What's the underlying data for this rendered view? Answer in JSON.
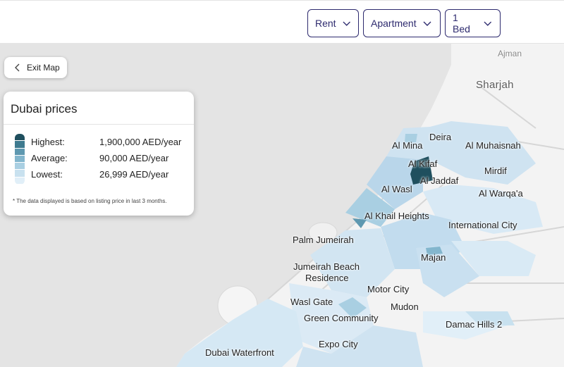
{
  "filters": {
    "listing": "Rent",
    "property_type": "Apartment",
    "bedrooms": "1 Bed"
  },
  "exit_label": "Exit Map",
  "legend": {
    "title": "Dubai prices",
    "highest_label": "Highest:",
    "highest_value": "1,900,000 AED/year",
    "average_label": "Average:",
    "average_value": "90,000 AED/year",
    "lowest_label": "Lowest:",
    "lowest_value": "26,999 AED/year",
    "note": "* The data displayed is based on listing price in last 3 months.",
    "scale_colors": [
      "#1f4f5e",
      "#3e7a8f",
      "#5e98b0",
      "#83b6cd",
      "#a9cfe2",
      "#c8e1ef",
      "#e1eff8"
    ]
  },
  "places": {
    "ajman": "Ajman",
    "sharjah": "Sharjah",
    "deira": "Deira",
    "al_mina": "Al Mina",
    "al_muhaisnah": "Al Muhaisnah",
    "al_kifaf": "Al Kifaf",
    "mirdif": "Mirdif",
    "al_jaddaf": "Al Jaddaf",
    "al_wasl": "Al Wasl",
    "al_warqaa": "Al Warqa'a",
    "al_khail_heights": "Al Khail Heights",
    "international_city": "International City",
    "palm_jumeirah": "Palm Jumeirah",
    "majan": "Majan",
    "jumeirah_beach_residence": "Jumeirah Beach",
    "jumeirah_beach_residence_2": "Residence",
    "motor_city": "Motor City",
    "wasl_gate": "Wasl Gate",
    "mudon": "Mudon",
    "green_community": "Green Community",
    "damac_hills_2": "Damac Hills 2",
    "expo_city": "Expo City",
    "dubai_waterfront": "Dubai Waterfront"
  },
  "colors": {
    "accent": "#2d2a6e",
    "land": "#f3f3f3",
    "sea": "#e4e4e4",
    "darkest_area": "#1f4f5e"
  }
}
